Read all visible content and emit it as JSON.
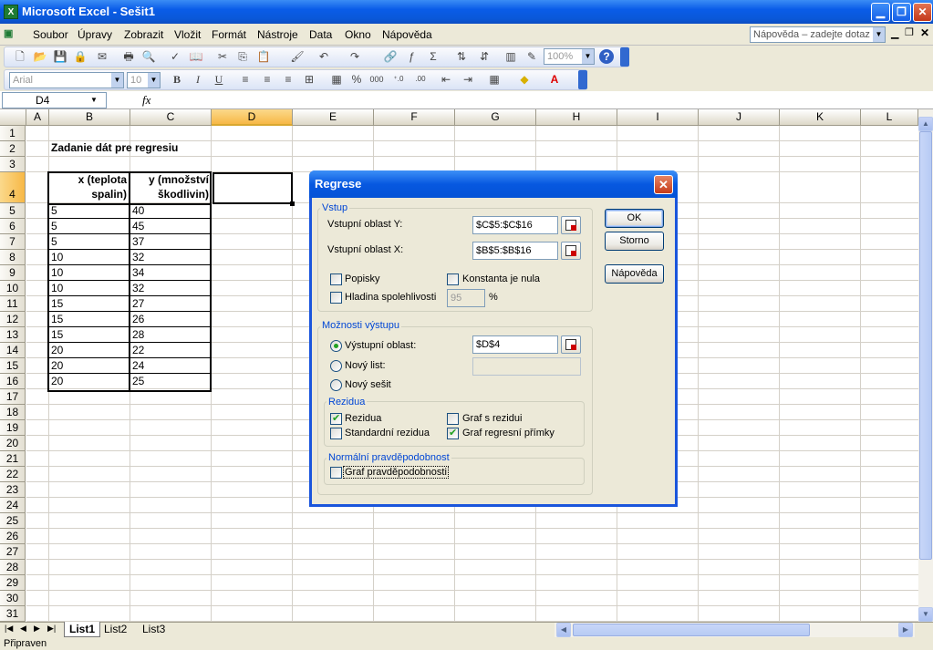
{
  "window": {
    "title": "Microsoft Excel - Sešit1"
  },
  "menu": {
    "items": [
      "Soubor",
      "Úpravy",
      "Zobrazit",
      "Vložit",
      "Formát",
      "Nástroje",
      "Data",
      "Okno",
      "Nápověda"
    ],
    "help_placeholder": "Nápověda – zadejte dotaz"
  },
  "toolbar": {
    "zoom": "100%",
    "font": "Arial",
    "font_size": "10"
  },
  "formula_bar": {
    "name_box": "D4",
    "fx": "fx",
    "value": ""
  },
  "columns": [
    "A",
    "B",
    "C",
    "D",
    "E",
    "F",
    "G",
    "H",
    "I",
    "J",
    "K",
    "L"
  ],
  "rows": [
    "1",
    "2",
    "3",
    "4",
    "5",
    "6",
    "7",
    "8",
    "9",
    "10",
    "11",
    "12",
    "13",
    "14",
    "15",
    "16",
    "17",
    "18",
    "19",
    "20",
    "21",
    "22",
    "23",
    "24",
    "25",
    "26",
    "27",
    "28",
    "29",
    "30",
    "31"
  ],
  "sheet": {
    "heading": "Zadanie dát pre regresiu",
    "header_x_line1": "x (teplota",
    "header_x_line2": "spalin)",
    "header_y_line1": "y (množství",
    "header_y_line2": "škodlivin)",
    "x_values": [
      "5",
      "5",
      "5",
      "10",
      "10",
      "10",
      "15",
      "15",
      "15",
      "20",
      "20",
      "20"
    ],
    "y_values": [
      "40",
      "45",
      "37",
      "32",
      "34",
      "32",
      "27",
      "26",
      "28",
      "22",
      "24",
      "25"
    ]
  },
  "sheet_tabs": [
    "List1",
    "List2",
    "List3"
  ],
  "status": {
    "text": "Připraven"
  },
  "dialog": {
    "title": "Regrese",
    "input_group": "Vstup",
    "input_y_label": "Vstupní oblast Y:",
    "input_y_value": "$C$5:$C$16",
    "input_x_label": "Vstupní oblast X:",
    "input_x_value": "$B$5:$B$16",
    "labels_chk": "Popisky",
    "const_zero_chk": "Konstanta je nula",
    "confidence_chk": "Hladina spolehlivosti",
    "confidence_value": "95",
    "percent": "%",
    "output_group": "Možnosti výstupu",
    "out_range_label": "Výstupní oblast:",
    "out_range_value": "$D$4",
    "new_sheet_label": "Nový list:",
    "new_book_label": "Nový sešit",
    "residuals_group": "Rezidua",
    "residuals_chk": "Rezidua",
    "std_residuals_chk": "Standardní rezidua",
    "residual_plot_chk": "Graf s rezidui",
    "line_fit_chk": "Graf regresní přímky",
    "normal_group": "Normální pravděpodobnost",
    "normal_plot_chk": "Graf pravděpodobnosti",
    "ok": "OK",
    "cancel": "Storno",
    "help": "Nápověda"
  }
}
